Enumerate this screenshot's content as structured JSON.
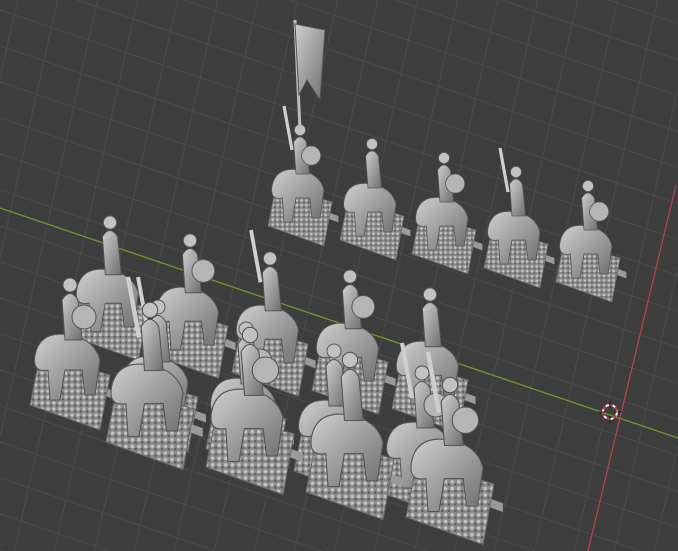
{
  "viewport": {
    "kind": "3d-viewport",
    "background_color": "#3d3d3d",
    "grid_color": "#4a4a4a",
    "x_axis_color": "#b0444e",
    "y_axis_color": "#6f9a2c",
    "model_color": "#a9a9a9",
    "cursor_icon": "3d-cursor-icon"
  }
}
